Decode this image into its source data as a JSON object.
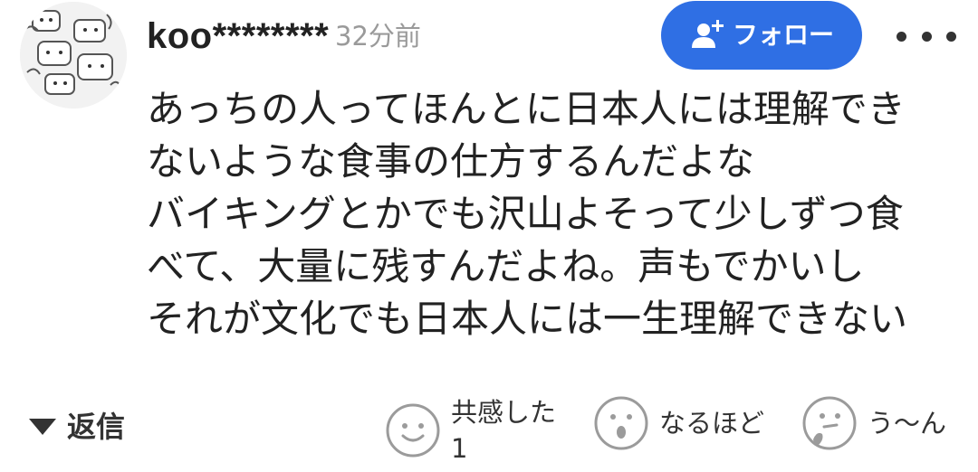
{
  "comment": {
    "username": "koo********",
    "timestamp": "32分前",
    "follow_label": "フォロー",
    "body_lines": [
      "あっちの人ってほんとに日本人には理解でき",
      "ないような食事の仕方するんだよな",
      "バイキングとかでも沢山よそって少しずつ食",
      "べて、大量に残すんだよね。声もでかいし",
      "それが文化でも日本人には一生理解できない"
    ]
  },
  "actions": {
    "reply_label": "返信",
    "reactions": [
      {
        "icon": "smile-face-icon",
        "label": "共感した",
        "count": "1"
      },
      {
        "icon": "surprised-face-icon",
        "label": "なるほど"
      },
      {
        "icon": "thinking-face-icon",
        "label": "う～ん"
      }
    ]
  },
  "colors": {
    "follow_button": "#2f6fe4",
    "timestamp_text": "#9a9a9a",
    "body_text": "#222222",
    "icon_gray": "#9b9b9b"
  }
}
